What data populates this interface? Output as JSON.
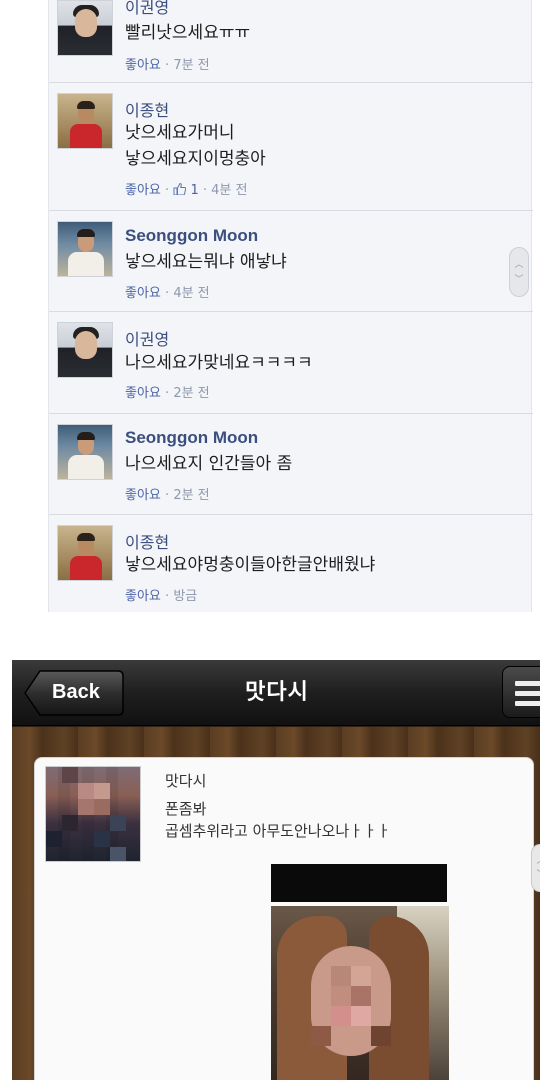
{
  "comments": [
    {
      "name": "이권영",
      "text": [
        "빨리낫으세요ㅠㅠ"
      ],
      "like": "좋아요",
      "time": "7분 전"
    },
    {
      "name": "이종현",
      "text": [
        "낫으세요가머니",
        "낳으세요지이멍충아"
      ],
      "like": "좋아요",
      "likes": "1",
      "time": "4분 전"
    },
    {
      "name": "Seonggon Moon",
      "text": [
        "낳으세요는뭐냐 애낳냐"
      ],
      "like": "좋아요",
      "time": "4분 전"
    },
    {
      "name": "이권영",
      "text": [
        "나으세요가맞네요ㅋㅋㅋㅋ"
      ],
      "like": "좋아요",
      "time": "2분 전"
    },
    {
      "name": "Seonggon Moon",
      "text": [
        "나으세요지 인간들아 좀"
      ],
      "like": "좋아요",
      "time": "2분 전"
    },
    {
      "name": "이종현",
      "text": [
        "낳으세요야멍충이들아한글안배웠냐"
      ],
      "like": "좋아요",
      "time": "방금"
    }
  ],
  "meta_separator": "·",
  "thumb_icon": "thumbs-up-icon",
  "app": {
    "back_label": "Back",
    "title": "맛다시",
    "menu_icon": "hamburger-menu-icon",
    "entry": {
      "name": "맛다시",
      "lines": [
        "폰좀봐",
        "곱셈추위라고 아무도안나오나ㅏㅏㅏ"
      ]
    }
  },
  "colors": {
    "name_link": "#3b4f7f",
    "meta_gray": "#8e98ad",
    "nav_dark": "#1f1f1f"
  }
}
